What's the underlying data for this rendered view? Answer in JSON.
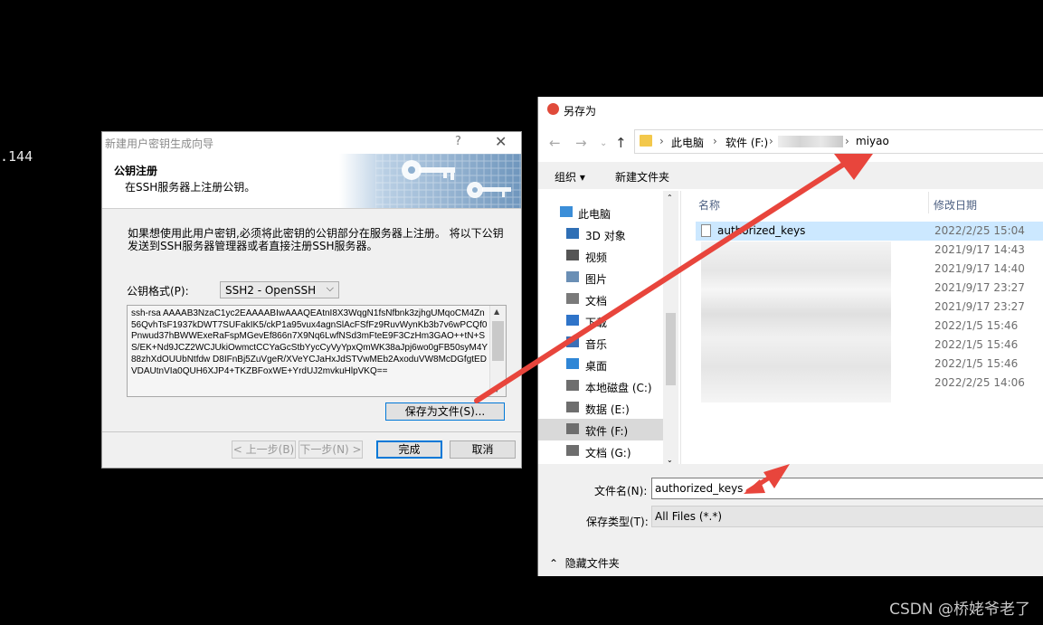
{
  "terminal": {
    "text": ".144"
  },
  "wizard": {
    "title": "新建用户密钥生成向导",
    "help": "?",
    "close": "✕",
    "header_title": "公钥注册",
    "header_subtitle": "在SSH服务器上注册公钥。",
    "description": "如果想使用此用户密钥,必须将此密钥的公钥部分在服务器上注册。 将以下公钥发送到SSH服务器管理器或者直接注册SSH服务器。",
    "format_label": "公钥格式(P):",
    "format_value": "SSH2 - OpenSSH",
    "key_text": "ssh-rsa AAAAB3NzaC1yc2EAAAABIwAAAQEAtnI8X3WqgN1fsNfbnk3zjhgUMqoCM4Zn56QvhTsF1937kDWT7SUFakIK5/ckP1a95vux4agnSlAcFSfFz9RuvWynKb3b7v6wPCQf0Pnwud37hBWWExeRaFspMGevEf866n7X9Nq6LwfNSd3mFteE9F3CzHm3GAO++tN+SS/EK+Nd9JCZ2WCJUkiOwmctCCYaGcStbYycCyVyYpxQmWK38aJpj6wo0gFB50syM4Y88zhXdOUUbNtfdw D8IFnBj5ZuVgeR/XVeYCJaHxJdSTVwMEb2AxoduVW8McDGfgtEDVDAUtnVIa0QUH6XJP4+TKZBFoxWE+YrdUJ2mvkuHlpVKQ==",
    "save_to_file": "保存为文件(S)...",
    "back": "< 上一步(B)",
    "next": "下一步(N) >",
    "finish": "完成",
    "cancel": "取消"
  },
  "save_dialog": {
    "title": "另存为",
    "address": {
      "crumb1": "此电脑",
      "crumb2": "软件 (F:)",
      "crumb3": "miyao"
    },
    "toolbar": {
      "organize": "组织 ▾",
      "new_folder": "新建文件夹"
    },
    "nav_items": [
      "此电脑",
      "3D 对象",
      "视频",
      "图片",
      "文档",
      "下载",
      "音乐",
      "桌面",
      "本地磁盘 (C:)",
      "数据 (E:)",
      "软件 (F:)",
      "文档 (G:)"
    ],
    "columns": {
      "name": "名称",
      "modified": "修改日期"
    },
    "files": [
      {
        "name": "authorized_keys",
        "date": "2022/2/25 15:04"
      },
      {
        "name": "",
        "date": "2021/9/17 14:43"
      },
      {
        "name": "",
        "date": "2021/9/17 14:40"
      },
      {
        "name": "",
        "date": "2021/9/17 23:27"
      },
      {
        "name": "",
        "date": "2021/9/17 23:27"
      },
      {
        "name": "",
        "date": "2022/1/5 15:46"
      },
      {
        "name": "",
        "date": "2022/1/5 15:46"
      },
      {
        "name": "",
        "date": "2022/1/5 15:46"
      },
      {
        "name": "",
        "date": "2022/2/25 14:06"
      }
    ],
    "filename_label": "文件名(N):",
    "filename_value": "authorized_keys",
    "filetype_label": "保存类型(T):",
    "filetype_value": "All Files (*.*)",
    "hide_folders": "隐藏文件夹"
  },
  "watermark": "CSDN @桥姥爷老了",
  "colors": {
    "arrow": "#e8453c",
    "selection": "#cce8ff",
    "accent": "#0078d7"
  }
}
